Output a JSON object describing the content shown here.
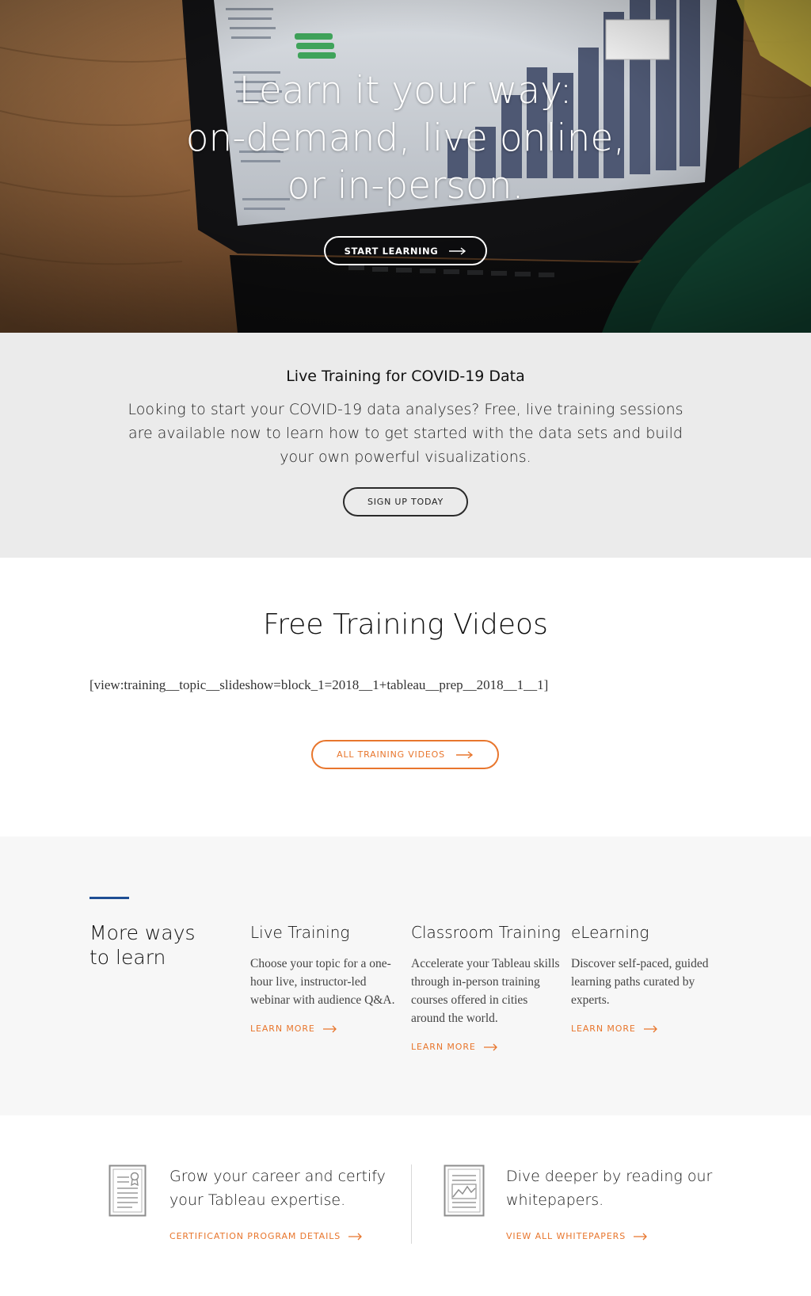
{
  "hero": {
    "title_lines": [
      "Learn it your way:",
      "on-demand, live online,",
      "or in-person."
    ],
    "cta_label": "START LEARNING"
  },
  "covid": {
    "title": "Live Training for COVID-19 Data",
    "text": "Looking to start your COVID-19 data analyses? Free, live training sessions are available now to learn how to get started with the data sets and build your own powerful visualizations.",
    "cta_label": "SIGN UP TODAY"
  },
  "videos": {
    "title": "Free Training Videos",
    "view_code": "[view:training__topic__slideshow=block_1=2018__1+tableau__prep__2018__1__1]",
    "cta_label": "ALL TRAINING VIDEOS"
  },
  "more_ways": {
    "title_line1": "More ways",
    "title_line2": "to learn",
    "columns": [
      {
        "title": "Live Training",
        "text": "Choose your topic for a one-hour live, instructor-led webinar with audience Q&A.",
        "link": "LEARN MORE"
      },
      {
        "title": "Classroom Training",
        "text": "Accelerate your Tableau skills through in-person training courses offered in cities around the world.",
        "link": "LEARN MORE"
      },
      {
        "title": "eLearning",
        "text": "Discover self-paced, guided learning paths curated by experts.",
        "link": "LEARN MORE"
      }
    ]
  },
  "bottom": {
    "left": {
      "text": "Grow your career and certify your Tableau expertise.",
      "link": "CERTIFICATION PROGRAM DETAILS",
      "icon": "certificate-icon"
    },
    "right": {
      "text": "Dive deeper by reading our whitepapers.",
      "link": "VIEW ALL WHITEPAPERS",
      "icon": "whitepaper-icon"
    }
  },
  "colors": {
    "accent_orange": "#e8762d",
    "accent_blue": "#1f4e94",
    "gray_band": "#ebebeb",
    "light_band": "#f7f7f7"
  }
}
